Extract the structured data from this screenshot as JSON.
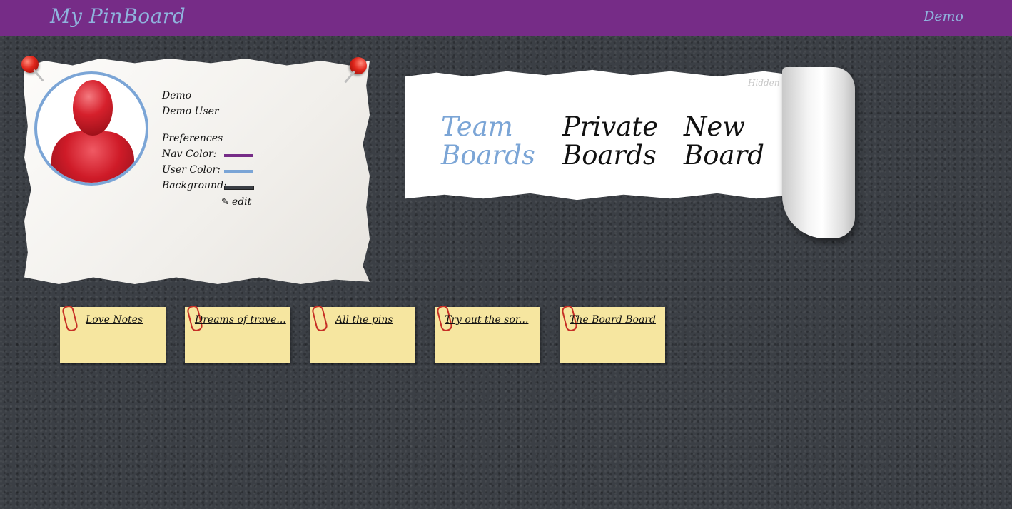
{
  "nav": {
    "brand": "My PinBoard",
    "user": "Demo",
    "color": "#762c87"
  },
  "profile": {
    "username": "Demo",
    "full_name": "Demo User",
    "preferences_heading": "Preferences",
    "nav_color_label": "Nav Color:",
    "user_color_label": "User Color:",
    "background_label": "Background:",
    "edit_label": "edit",
    "nav_color": "#762c87",
    "user_color": "#7ba5d6",
    "background_color": "#3b3f45"
  },
  "menu": {
    "hidden_label": "Hidden",
    "team": {
      "line1": "Team",
      "line2": "Boards"
    },
    "private": {
      "line1": "Private",
      "line2": "Boards"
    },
    "new": {
      "line1": "New",
      "line2": "Board"
    }
  },
  "boards": [
    {
      "title": "Love Notes"
    },
    {
      "title": "Dreams of trave..."
    },
    {
      "title": "All the pins"
    },
    {
      "title": "Try out the sor..."
    },
    {
      "title": "The Board Board"
    }
  ]
}
